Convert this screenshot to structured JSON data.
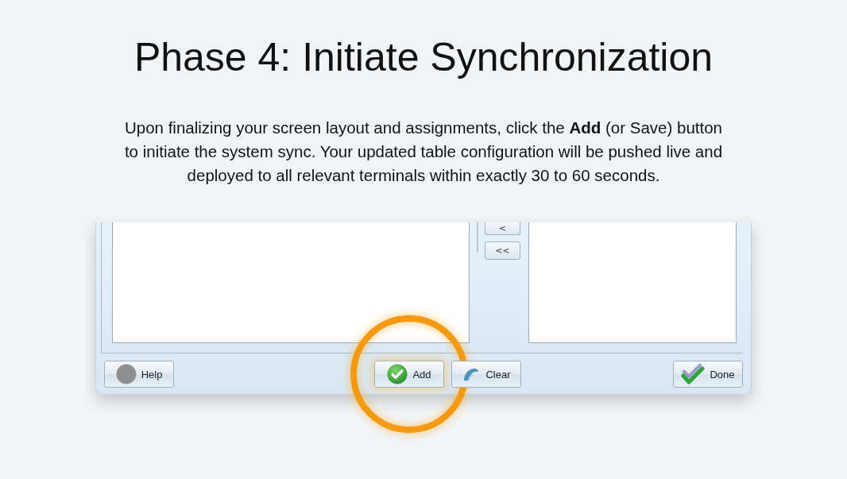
{
  "title": "Phase 4: Initiate Synchronization",
  "description": "Upon finalizing your screen layout and assignments, click the **Add** (or Save) button to initiate the system sync. Your updated table configuration will be pushed live and deployed to all relevant terminals within exactly 30 to 60 seconds.",
  "dialog": {
    "move_buttons": [
      "<",
      "<<"
    ],
    "buttons": [
      {
        "label": "Help",
        "kind": "help",
        "highlighted": false
      },
      {
        "label": "Add",
        "kind": "add",
        "highlighted": true
      },
      {
        "label": "Clear",
        "kind": "clear",
        "highlighted": false
      },
      {
        "label": "Done",
        "kind": "done",
        "highlighted": false
      }
    ]
  }
}
